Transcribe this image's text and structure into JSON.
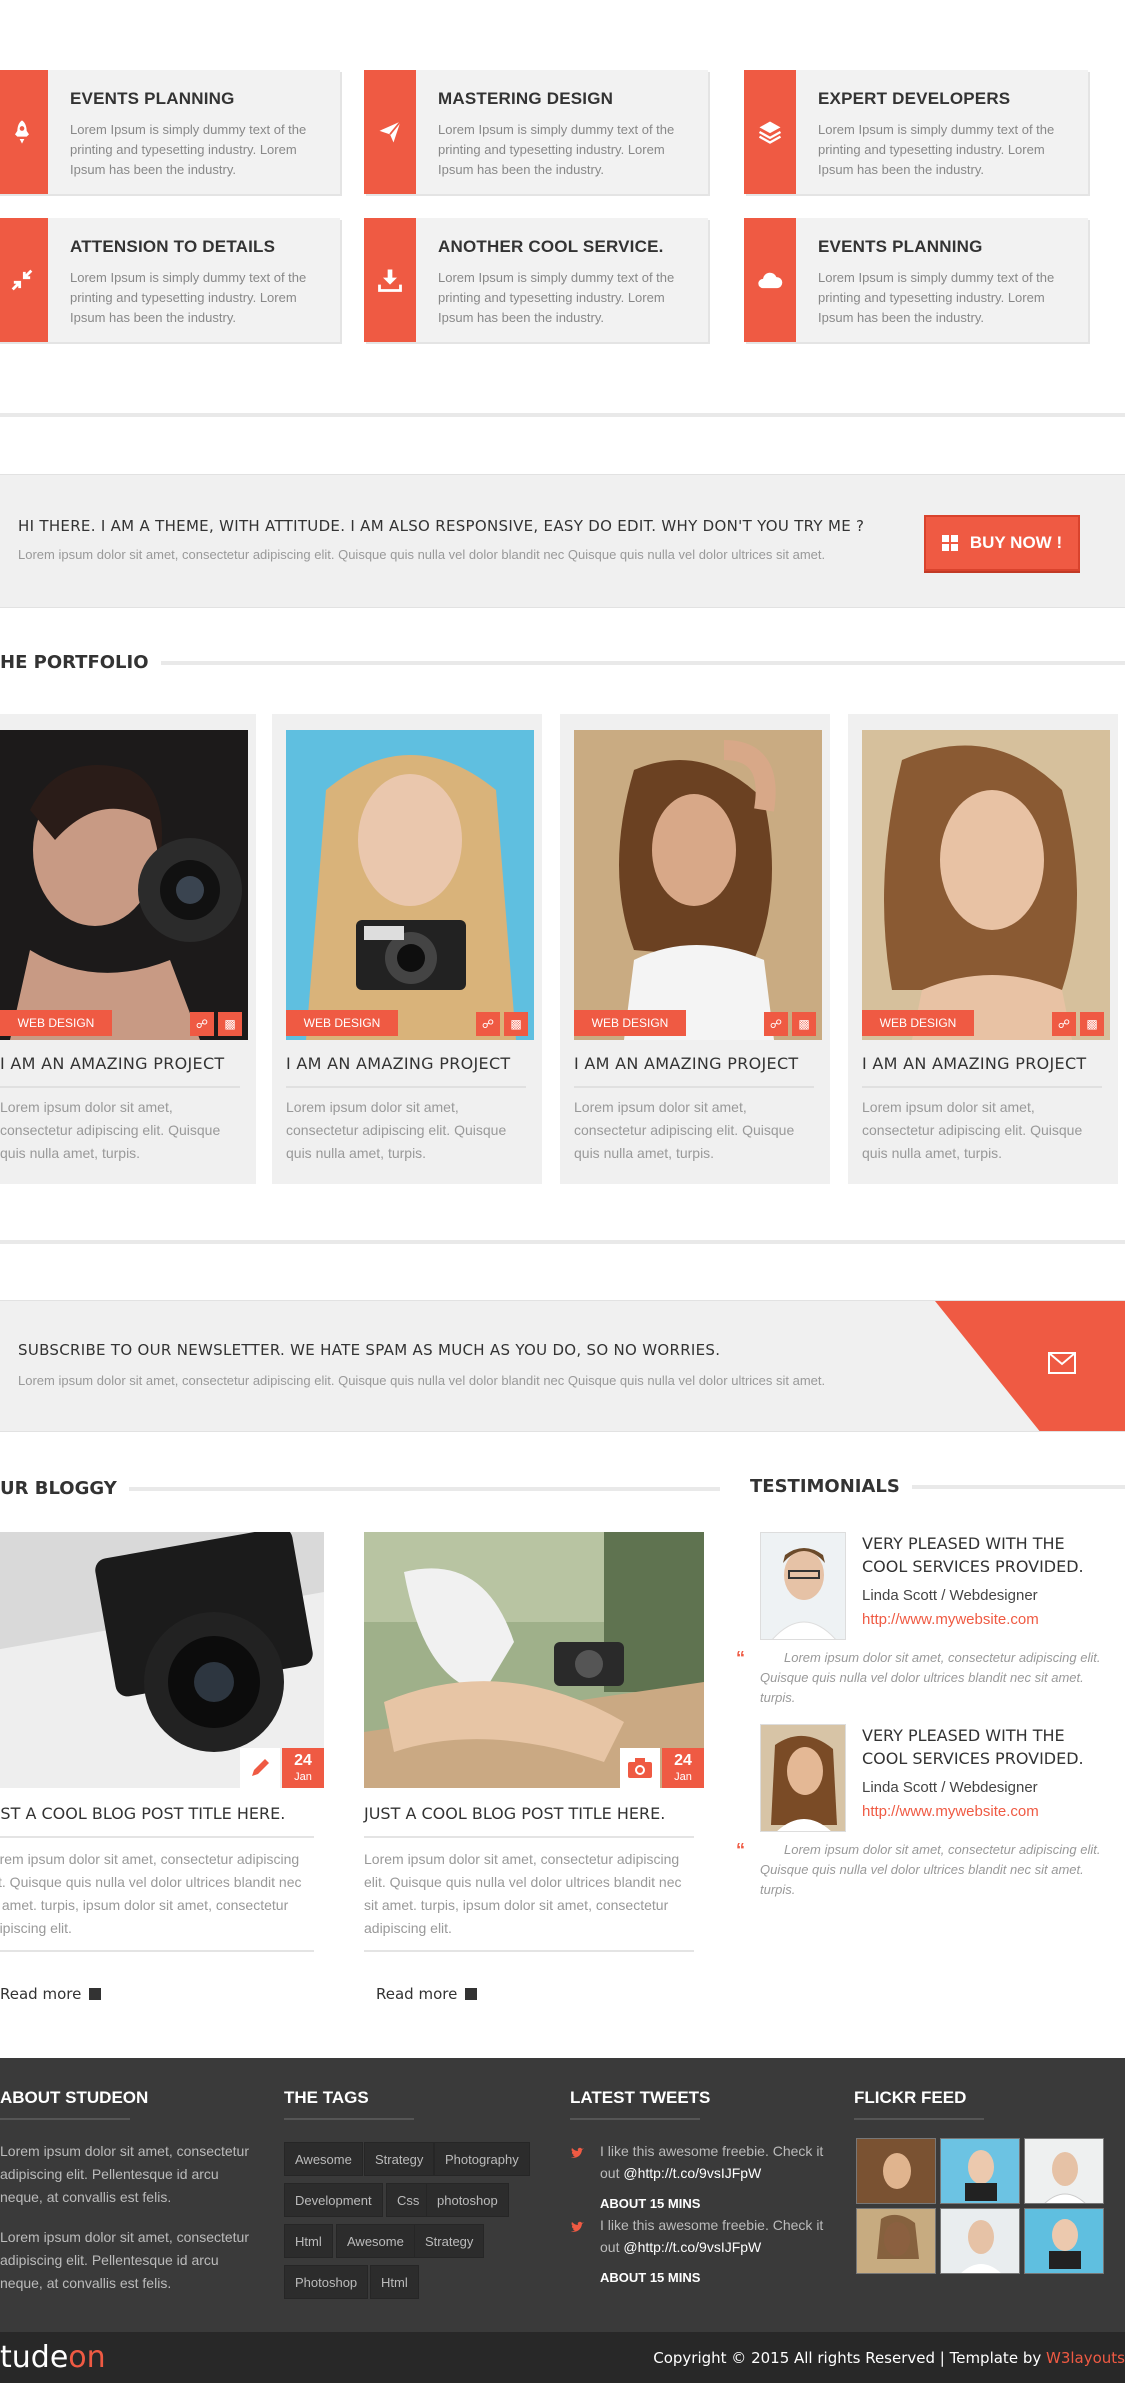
{
  "services": [
    {
      "title": "EVENTS PLANNING",
      "text": "Lorem Ipsum is simply dummy text of the printing and typesetting industry. Lorem Ipsum has been the industry.",
      "icon": "rocket-icon"
    },
    {
      "title": "MASTERING DESIGN",
      "text": "Lorem Ipsum is simply dummy text of the printing and typesetting industry. Lorem Ipsum has been the industry.",
      "icon": "paper-plane-icon"
    },
    {
      "title": "EXPERT DEVELOPERS",
      "text": "Lorem Ipsum is simply dummy text of the printing and typesetting industry. Lorem Ipsum has been the industry.",
      "icon": "layers-icon"
    },
    {
      "title": "ATTENSION TO DETAILS",
      "text": "Lorem Ipsum is simply dummy text of the printing and typesetting industry. Lorem Ipsum has been the industry.",
      "icon": "compress-icon"
    },
    {
      "title": "ANOTHER COOL SERVICE.",
      "text": "Lorem Ipsum is simply dummy text of the printing and typesetting industry. Lorem Ipsum has been the industry.",
      "icon": "download-icon"
    },
    {
      "title": "EVENTS PLANNING",
      "text": "Lorem Ipsum is simply dummy text of the printing and typesetting industry. Lorem Ipsum has been the industry.",
      "icon": "cloud-icon"
    }
  ],
  "cta": {
    "heading": "HI THERE. I AM A THEME, WITH ATTITUDE. I AM ALSO RESPONSIVE, EASY DO EDIT. WHY DON'T YOU TRY ME ?",
    "text": "Lorem ipsum dolor sit amet, consectetur adipiscing elit. Quisque quis nulla vel dolor blandit nec Quisque quis nulla vel dolor ultrices sit amet.",
    "button": "BUY NOW !"
  },
  "portfolio": {
    "heading": "HE PORTFOLIO",
    "items": [
      {
        "tag": "WEB DESIGN",
        "title": "I AM AN AMAZING PROJECT",
        "text": "Lorem ipsum dolor sit amet, consectetur adipiscing elit. Quisque quis nulla amet, turpis."
      },
      {
        "tag": "WEB DESIGN",
        "title": "I AM AN AMAZING PROJECT",
        "text": "Lorem ipsum dolor sit amet, consectetur adipiscing elit. Quisque quis nulla amet, turpis."
      },
      {
        "tag": "WEB DESIGN",
        "title": "I AM AN AMAZING PROJECT",
        "text": "Lorem ipsum dolor sit amet, consectetur adipiscing elit. Quisque quis nulla amet, turpis."
      },
      {
        "tag": "WEB DESIGN",
        "title": "I AM AN AMAZING PROJECT",
        "text": "Lorem ipsum dolor sit amet, consectetur adipiscing elit. Quisque quis nulla amet, turpis."
      }
    ]
  },
  "newsletter": {
    "heading": "SUBSCRIBE TO OUR NEWSLETTER. WE HATE SPAM AS MUCH AS YOU DO, SO NO WORRIES.",
    "text": "Lorem ipsum dolor sit amet, consectetur adipiscing elit. Quisque quis nulla vel dolor blandit nec Quisque quis nulla vel dolor ultrices sit amet."
  },
  "blog": {
    "heading": "UR BLOGGY",
    "posts": [
      {
        "day": "24",
        "month": "Jan",
        "title": "JUST A COOL BLOG POST TITLE HERE.",
        "text": "Lorem ipsum dolor sit amet, consectetur adipiscing elit. Quisque quis nulla vel dolor ultrices blandit nec sit amet. turpis, ipsum dolor sit amet, consectetur adipiscing elit.",
        "more": "Read more"
      },
      {
        "day": "24",
        "month": "Jan",
        "title": "JUST A COOL BLOG POST TITLE HERE.",
        "text": "Lorem ipsum dolor sit amet, consectetur adipiscing elit. Quisque quis nulla vel dolor ultrices blandit nec sit amet. turpis, ipsum dolor sit amet, consectetur adipiscing elit.",
        "more": "Read more"
      }
    ]
  },
  "testimonials": {
    "heading": "TESTIMONIALS",
    "items": [
      {
        "quote": "VERY PLEASED WITH THE COOL SERVICES PROVIDED.",
        "name": "Linda Scott / Webdesigner",
        "url": "http://www.mywebsite.com",
        "text": "Lorem ipsum dolor sit amet, consectetur adipiscing elit. Quisque quis nulla vel dolor ultrices blandit nec sit amet. turpis."
      },
      {
        "quote": "VERY PLEASED WITH THE COOL SERVICES PROVIDED.",
        "name": "Linda Scott / Webdesigner",
        "url": "http://www.mywebsite.com",
        "text": "Lorem ipsum dolor sit amet, consectetur adipiscing elit. Quisque quis nulla vel dolor ultrices blandit nec sit amet. turpis."
      }
    ]
  },
  "footer": {
    "about": {
      "heading": "ABOUT STUDEON",
      "p1": "Lorem ipsum dolor sit amet, consectetur adipiscing elit. Pellentesque id arcu neque, at convallis est felis.",
      "p2": "Lorem ipsum dolor sit amet, consectetur adipiscing elit. Pellentesque id arcu neque, at convallis est felis."
    },
    "tags": {
      "heading": "THE TAGS",
      "items": [
        "Awesome",
        "Strategy",
        "Photography",
        "Development",
        "Css",
        "photoshop",
        "Html",
        "Awesome",
        "Strategy",
        "Photoshop",
        "Html"
      ]
    },
    "tweets": {
      "heading": "LATEST TWEETS",
      "items": [
        {
          "text": "I like this awesome freebie. Check it out",
          "link": "@http://t.co/9vsIJFpW",
          "time": "ABOUT 15 MINS"
        },
        {
          "text": "I like this awesome freebie. Check it out",
          "link": "@http://t.co/9vsIJFpW",
          "time": "ABOUT 15 MINS"
        }
      ]
    },
    "flickr": {
      "heading": "FLICKR FEED"
    }
  },
  "bottom": {
    "logo_main": "tude",
    "logo_accent": "on",
    "copyright": "Copyright © 2015 All rights Reserved | Template by",
    "credit": "W3layouts"
  },
  "colors": {
    "accent": "#ef5a43",
    "footer": "#3a3a3a",
    "bottombar": "#282828"
  }
}
